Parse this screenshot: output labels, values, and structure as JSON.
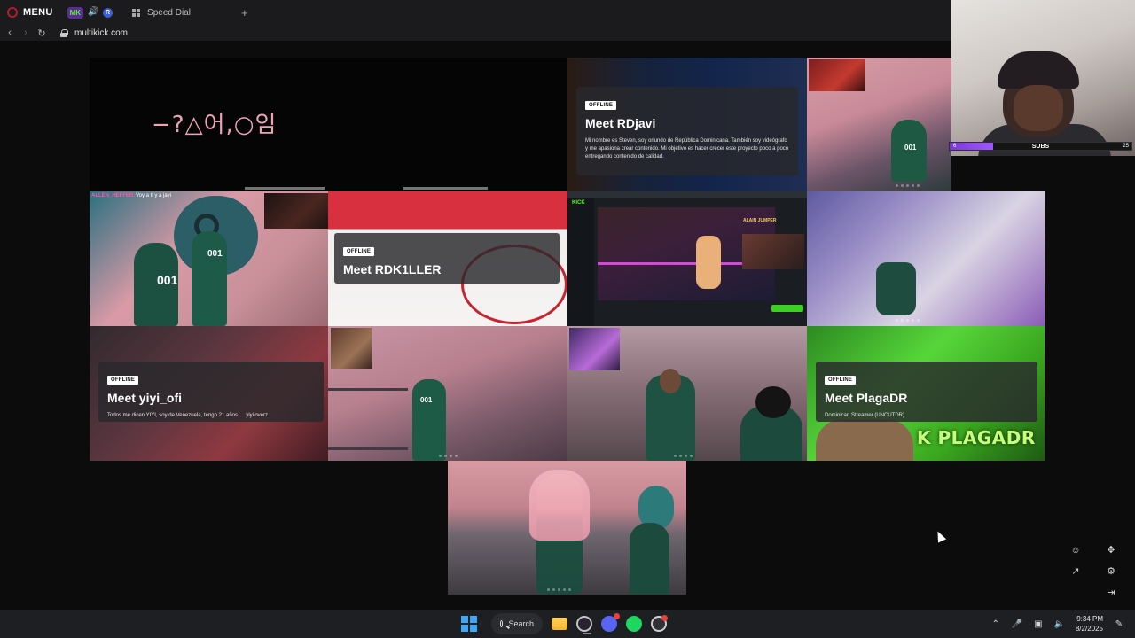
{
  "browser": {
    "menu_label": "MENU",
    "tab_title": "Speed Dial",
    "url": "multikick.com",
    "ext_badge": "MK",
    "profile_initial": "R"
  },
  "tiles": {
    "squid_logo": "−?△어,○임",
    "rdjavi": {
      "badge": "OFFLINE",
      "title": "Meet RDjavi",
      "desc": "Mi nombre es Steven, soy oriundo de República Dominicana. También soy videógrafo y me apasiona crear contenido. Mi objetivo es hacer crecer este proyecto poco a poco entregando contenido de calidad."
    },
    "rdk": {
      "badge": "OFFLINE",
      "title": "Meet RDK1LLER"
    },
    "yiyi": {
      "badge": "OFFLINE",
      "title": "Meet yiyi_ofi",
      "desc": "Todos me dicen YIYI, soy de Venezuela, tengo 21 años.",
      "social": "yiyiloverz"
    },
    "plaga": {
      "badge": "OFFLINE",
      "title": "Meet PlagaDR",
      "desc": "Dominican Streamer (UNCUTDR)",
      "tag": "K PLAGADR"
    },
    "chat_001": {
      "user": "ALLEN_HEFFER:",
      "message": "Voy a ti y a javi"
    },
    "jersey_001": "001",
    "kick_label": "KICK",
    "fighter_label": "ALAIN JUMPER"
  },
  "subs_bar": {
    "label": "SUBS",
    "current": "6",
    "goal": "25",
    "progress": 0.24
  },
  "taskbar": {
    "search_label": "Search",
    "time": "9:34 PM",
    "date": "8/2/2025",
    "discord_badge": "1"
  },
  "colors": {
    "kick_green": "#53fc18",
    "subs_purple": "#a056ff",
    "taskbar_bg": "#1e1f22"
  },
  "icons": [
    "opera-logo-icon",
    "speaker-icon",
    "grid-icon",
    "plus-icon",
    "back-icon",
    "forward-icon",
    "reload-icon",
    "lock-icon",
    "add-user-icon",
    "move-icon",
    "share-icon",
    "settings-icon",
    "exit-icon",
    "windows-icon",
    "search-icon",
    "folder-icon",
    "opera-icon",
    "discord-icon",
    "spotify-icon",
    "chrome-icon",
    "chevron-up-icon",
    "mic-icon",
    "display-icon",
    "volume-icon",
    "notification-icon"
  ]
}
